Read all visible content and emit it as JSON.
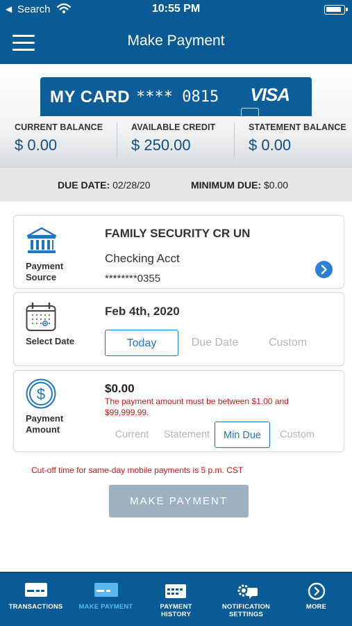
{
  "status_bar": {
    "back_glyph": "◀",
    "carrier": "Search",
    "time": "10:55 PM"
  },
  "header": {
    "title": "Make Payment"
  },
  "card": {
    "name": "MY CARD",
    "number_masked": "**** 0815",
    "brand": "VISA"
  },
  "balances": [
    {
      "label": "CURRENT BALANCE",
      "value": "$ 0.00"
    },
    {
      "label": "AVAILABLE CREDIT",
      "value": "$ 250.00"
    },
    {
      "label": "STATEMENT BALANCE",
      "value": "$ 0.00"
    }
  ],
  "due": {
    "due_date_label": "DUE DATE:",
    "due_date_value": "02/28/20",
    "min_due_label": "MINIMUM DUE:",
    "min_due_value": "$0.00"
  },
  "payment_source": {
    "icon": "bank-icon",
    "label_line1": "Payment",
    "label_line2": "Source",
    "bank_name": "FAMILY SECURITY CR UN",
    "account_type": "Checking Acct",
    "account_number": "********0355"
  },
  "select_date": {
    "icon": "calendar-icon",
    "label": "Select Date",
    "value": "Feb 4th, 2020",
    "options": [
      "Today",
      "Due Date",
      "Custom"
    ],
    "selected": "Today"
  },
  "payment_amount": {
    "icon": "dollar-icon",
    "label_line1": "Payment",
    "label_line2": "Amount",
    "value": "$0.00",
    "warning": "The payment amount must be between $1.00 and $99,999.99.",
    "options": [
      "Current",
      "Statement",
      "Min Due",
      "Custom"
    ],
    "selected": "Min Due"
  },
  "cutoff_notice": "Cut-off time for same-day mobile payments is 5 p.m. CST",
  "make_payment_button": "MAKE PAYMENT",
  "tabbar": {
    "tabs": [
      {
        "label": "TRANSACTIONS",
        "icon": "card-list-icon"
      },
      {
        "label": "MAKE PAYMENT",
        "icon": "card-icon",
        "active": true
      },
      {
        "label_line1": "PAYMENT",
        "label_line2": "HISTORY",
        "icon": "history-calendar-icon"
      },
      {
        "label_line1": "NOTIFICATION",
        "label_line2": "SETTINGS",
        "icon": "gear-chat-icon"
      },
      {
        "label": "MORE",
        "icon": "chevron-right-circle-icon"
      }
    ]
  },
  "colors": {
    "brand_blue": "#0a5a96",
    "accent_blue": "#1f76c6",
    "warning_red": "#d31616",
    "disabled_button": "#9fb0c2"
  }
}
